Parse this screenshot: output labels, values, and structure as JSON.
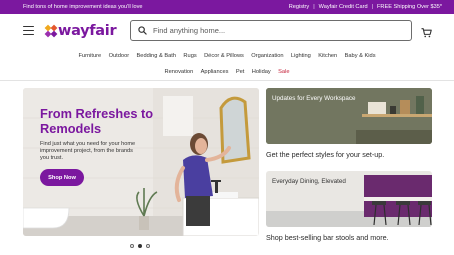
{
  "promo_bar": {
    "left_text": "Find tons of home improvement ideas you'll love",
    "links": [
      "Registry",
      "Wayfair Credit Card",
      "FREE Shipping Over $35*"
    ]
  },
  "header": {
    "logo_text": "wayfair",
    "search_placeholder": "Find anything home...",
    "menu_icon": "hamburger-menu-icon",
    "search_icon": "search-icon",
    "cart_icon": "shopping-cart-icon"
  },
  "nav": {
    "row1": [
      "Furniture",
      "Outdoor",
      "Bedding & Bath",
      "Rugs",
      "Décor & Pillows",
      "Organization",
      "Lighting",
      "Kitchen",
      "Baby & Kids"
    ],
    "row2": [
      "Renovation",
      "Appliances",
      "Pet",
      "Holiday",
      "Sale"
    ]
  },
  "hero": {
    "title": "From Refreshes to Remodels",
    "subtitle": "Find just what you need for your home improvement project, from the brands you trust.",
    "cta": "Shop Now"
  },
  "cards": [
    {
      "overlay": "Updates for Every Workspace",
      "caption": "Get the perfect styles for your set-up."
    },
    {
      "overlay": "Everyday Dining, Elevated",
      "caption": "Shop best-selling bar stools and more."
    }
  ],
  "carousel": {
    "total": 3,
    "active": 2
  },
  "colors": {
    "brand_purple": "#7b189f",
    "sale_red": "#c5223a"
  }
}
